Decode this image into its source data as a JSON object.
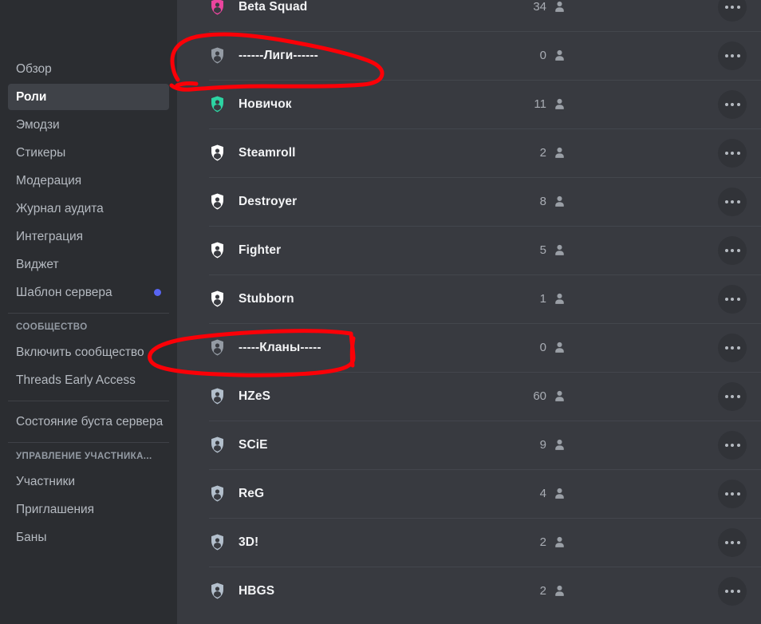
{
  "sidebar": {
    "items": [
      {
        "label": "Обзор",
        "active": false,
        "dot": false
      },
      {
        "label": "Роли",
        "active": true,
        "dot": false
      },
      {
        "label": "Эмодзи",
        "active": false,
        "dot": false
      },
      {
        "label": "Стикеры",
        "active": false,
        "dot": false
      },
      {
        "label": "Модерация",
        "active": false,
        "dot": false
      },
      {
        "label": "Журнал аудита",
        "active": false,
        "dot": false
      },
      {
        "label": "Интеграция",
        "active": false,
        "dot": false
      },
      {
        "label": "Виджет",
        "active": false,
        "dot": false
      },
      {
        "label": "Шаблон сервера",
        "active": false,
        "dot": true
      }
    ],
    "community_header": "СООБЩЕСТВО",
    "community_items": [
      {
        "label": "Включить сообщество"
      },
      {
        "label": "Threads Early Access"
      }
    ],
    "boost_items": [
      {
        "label": "Состояние буста сервера"
      }
    ],
    "members_header": "УПРАВЛЕНИЕ УЧАСТНИКА...",
    "members_items": [
      {
        "label": "Участники"
      },
      {
        "label": "Приглашения"
      },
      {
        "label": "Баны"
      }
    ]
  },
  "roles": {
    "more_icon": "ellipsis-icon",
    "member_icon": "person-icon",
    "rows": [
      {
        "name": "Beta Squad",
        "count": "34",
        "color": "#eb459e"
      },
      {
        "name": "------Лиги------",
        "count": "0",
        "color": "#949ba4"
      },
      {
        "name": "Новичок",
        "count": "11",
        "color": "#2dd4a3"
      },
      {
        "name": "Steamroll",
        "count": "2",
        "color": "#ffffff"
      },
      {
        "name": "Destroyer",
        "count": "8",
        "color": "#ffffff"
      },
      {
        "name": "Fighter",
        "count": "5",
        "color": "#ffffff"
      },
      {
        "name": "Stubborn",
        "count": "1",
        "color": "#ffffff"
      },
      {
        "name": "-----Кланы-----",
        "count": "0",
        "color": "#949ba4"
      },
      {
        "name": "HZeS",
        "count": "60",
        "color": "#b3bfcc"
      },
      {
        "name": "SCiE",
        "count": "9",
        "color": "#b3bfcc"
      },
      {
        "name": "ReG",
        "count": "4",
        "color": "#b3bfcc"
      },
      {
        "name": "3D!",
        "count": "2",
        "color": "#b3bfcc"
      },
      {
        "name": "HBGS",
        "count": "2",
        "color": "#b3bfcc"
      }
    ]
  },
  "annotations": {
    "color": "#fb0007",
    "marks": [
      {
        "name": "circle-around-ligi-row"
      },
      {
        "name": "circle-around-klany-row"
      }
    ]
  }
}
